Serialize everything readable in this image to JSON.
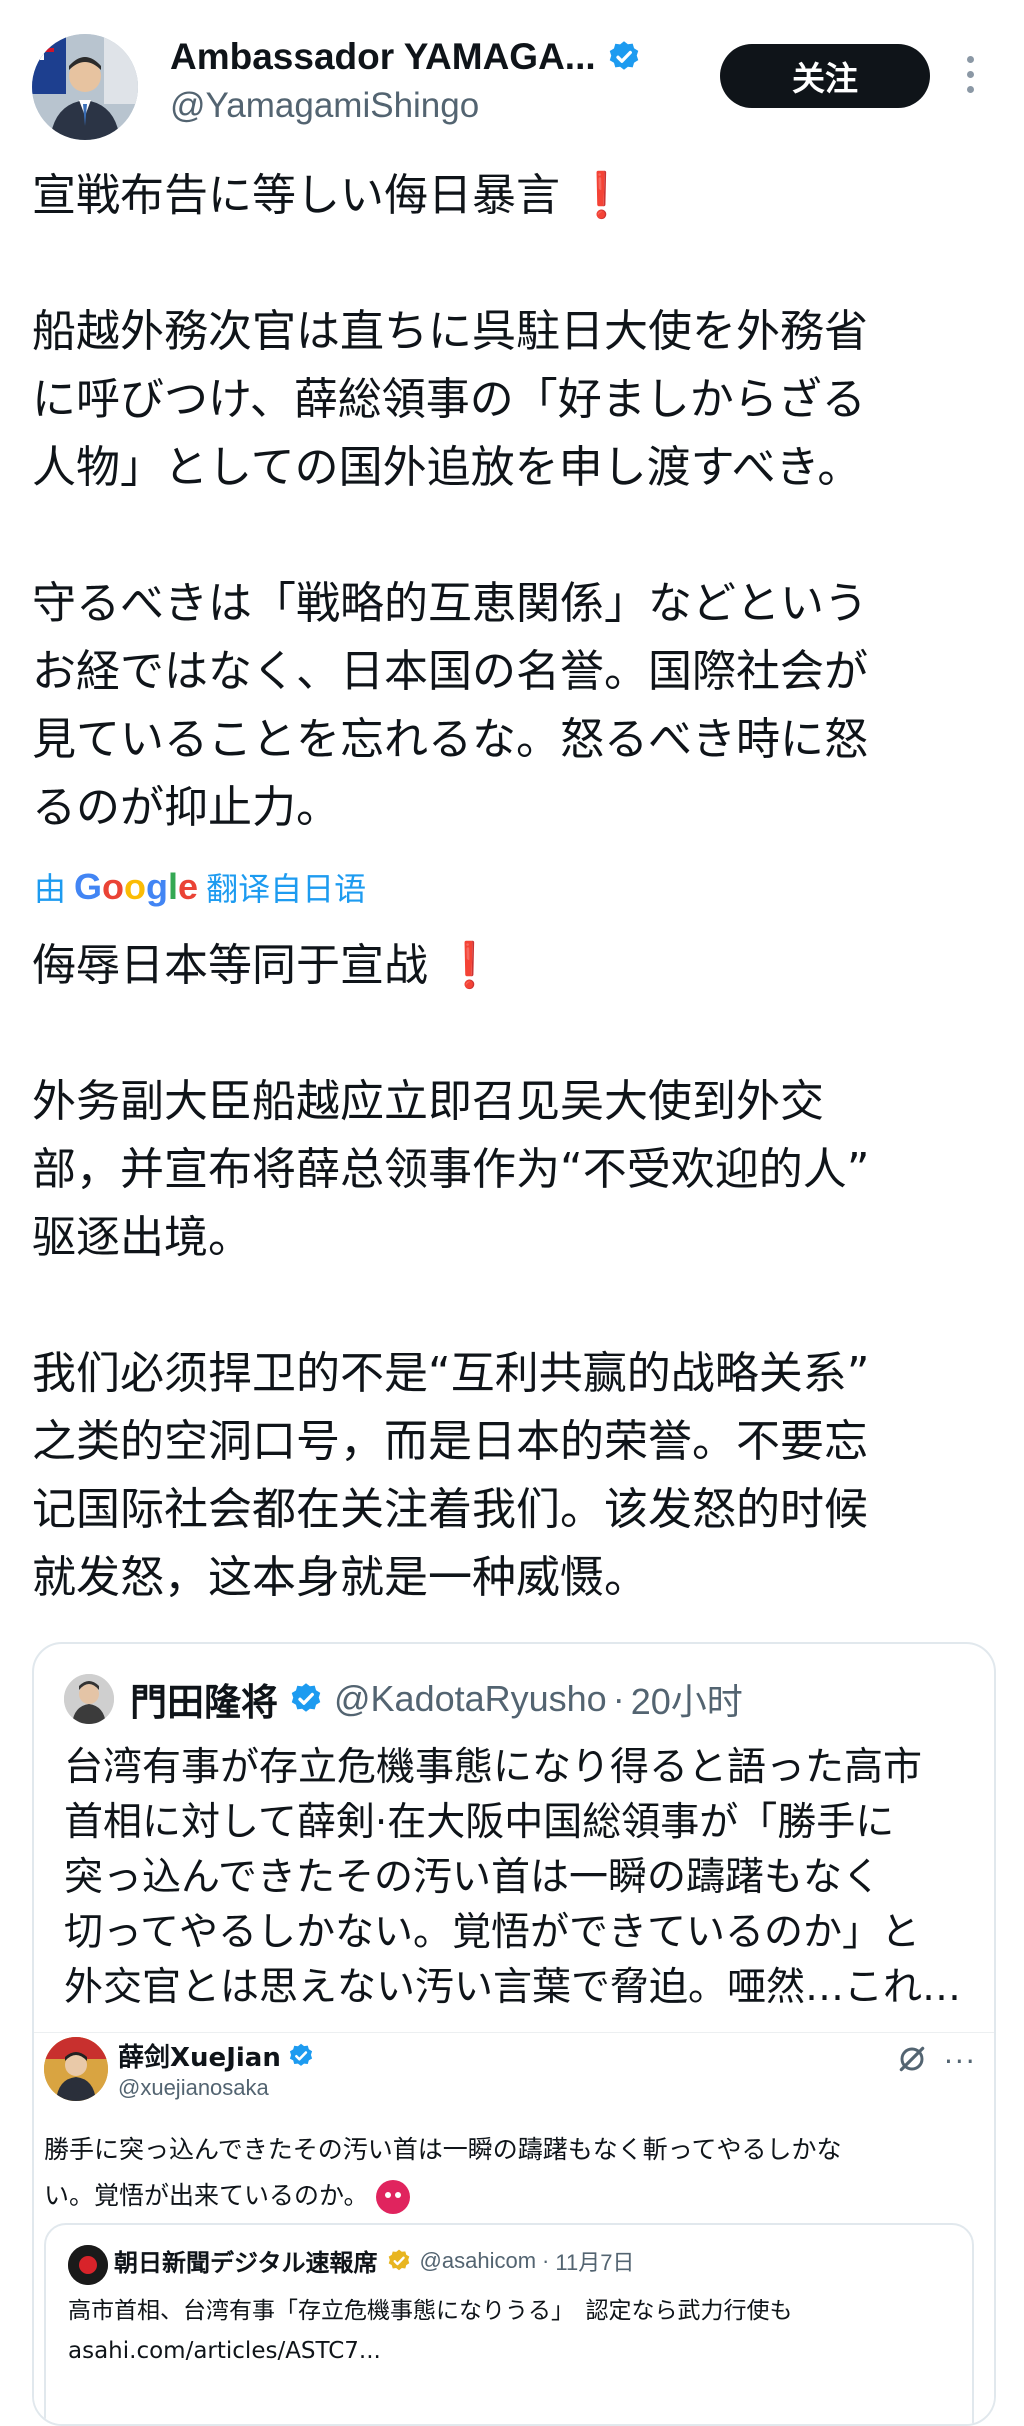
{
  "tweet": {
    "author_name": "Ambassador YAMAGA...",
    "author_handle": "@YamagamiShingo",
    "follow_label": "关注",
    "body_original_line1": "宣戦布告に等しい侮日暴言",
    "body_original_rest": "\n船越外務次官は直ちに呉駐日大使を外務省\nに呼びつけ、薛総領事の「好ましからざる\n人物」としての国外追放を申し渡すべき。\n\n守るべきは「戦略的互恵関係」などという\nお経ではなく、日本国の名誉。国際社会が\n見ていることを忘れるな。怒るべき時に怒\nるのが抑止力。",
    "translation_prefix": "由",
    "translation_google": "Google",
    "translation_suffix": "翻译自日语",
    "body_translated_line1": "侮辱日本等同于宣战",
    "body_translated_rest": "\n外务副大臣船越应立即召见吴大使到外交\n部，并宣布将薛总领事作为“不受欢迎的人”\n驱逐出境。\n\n我们必须捍卫的不是“互利共赢的战略关系”\n之类的空洞口号，而是日本的荣誉。不要忘\n记国际社会都在关注着我们。该发怒的时候\n就发怒，这本身就是一种威慑。",
    "exclamation": "❗"
  },
  "quote": {
    "author_name": "門田隆将",
    "author_handle": "@KadotaRyusho",
    "separator": "·",
    "time": "20小时",
    "text": "台湾有事が存立危機事態になり得ると語った高市\n首相に対して薛剣·在大阪中国総領事が「勝手に\n突っ込んできたその汚い首は一瞬の躊躇もなく\n切ってやるしかない。覚悟ができているのか」と\n外交官とは思えない汚い言葉で脅迫。唖然…これ…"
  },
  "screenshot": {
    "author_name": "薛剑XueJian",
    "author_handle": "@xuejianosaka",
    "more_label": "···",
    "text": "勝手に突っ込んできたその汚い首は一瞬の躊躇もなく斬ってやるしかな\nい。覚悟が出来ているのか。",
    "nested": {
      "author_name": "朝日新聞デジタル速報席",
      "author_handle": "@asahicom",
      "separator": "·",
      "time": "11月7日",
      "text": "高市首相、台湾有事「存立危機事態になりうる」　認定なら武力行使も\nasahi.com/articles/ASTC7..."
    }
  },
  "colors": {
    "verified_blue": "#1d9bf0",
    "gold_badge": "#e8b520",
    "follow_button_bg": "#0f1419",
    "translate_link": "#1d9bf0",
    "exclamation_red": "#e0245e"
  }
}
